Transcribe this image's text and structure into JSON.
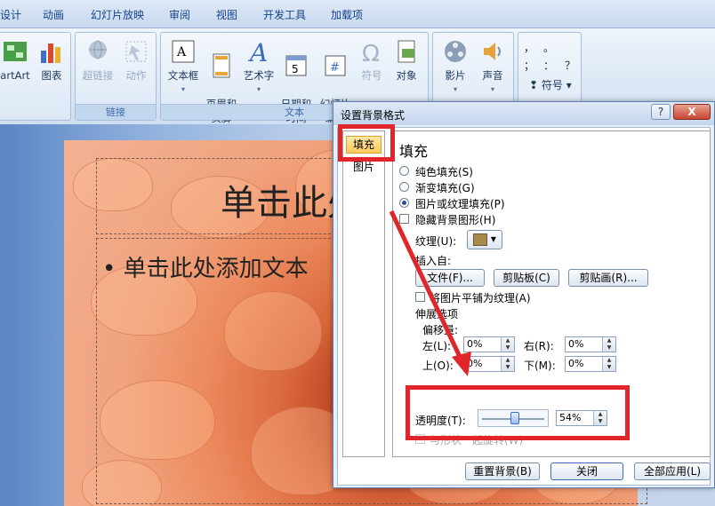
{
  "ribbon_tabs": [
    "设计",
    "动画",
    "幻灯片放映",
    "审阅",
    "视图",
    "开发工具",
    "加载项"
  ],
  "ribbon": {
    "group1": {
      "buttons": [
        {
          "label": "artArt",
          "icon": "smartart-icon"
        },
        {
          "label": "图表",
          "icon": "chart-icon"
        }
      ]
    },
    "group_links": {
      "label": "链接",
      "buttons": [
        {
          "label": "超链接",
          "icon": "hyperlink-icon",
          "disabled": true
        },
        {
          "label": "动作",
          "icon": "action-icon",
          "disabled": true
        }
      ]
    },
    "group_text": {
      "label": "文本",
      "buttons": [
        {
          "label": "文本框",
          "icon": "textbox-icon"
        },
        {
          "label": "页眉和\n页脚",
          "icon": "header-footer-icon"
        },
        {
          "label": "艺术字",
          "icon": "wordart-icon"
        },
        {
          "label": "日期和\n时间",
          "icon": "calendar-icon"
        },
        {
          "label": "幻灯片\n编号",
          "icon": "slide-number-icon"
        },
        {
          "label": "符号",
          "icon": "omega-icon",
          "disabled": true
        },
        {
          "label": "对象",
          "icon": "object-icon"
        }
      ]
    },
    "group_media": {
      "buttons": [
        {
          "label": "影片",
          "icon": "film-icon"
        },
        {
          "label": "声音",
          "icon": "speaker-icon"
        }
      ]
    },
    "group_symbol": {
      "symbols": [
        "，",
        "。",
        "；",
        "：",
        "？"
      ],
      "button": "符号"
    }
  },
  "slide": {
    "title_placeholder": "单击此处添加标题",
    "body_placeholder": "单击此处添加文本"
  },
  "dialog": {
    "title": "设置背景格式",
    "help": "?",
    "close": "X",
    "categories": [
      "填充",
      "图片"
    ],
    "section_title": "填充",
    "fill_options": [
      "纯色填充(S)",
      "渐变填充(G)",
      "图片或纹理填充(P)"
    ],
    "selected_fill": 2,
    "hide_background": "隐藏背景图形(H)",
    "texture_label": "纹理(U):",
    "insert_from": "插入自:",
    "insert_buttons": [
      "文件(F)...",
      "剪贴板(C)",
      "剪贴画(R)..."
    ],
    "tile_checkbox": "将图片平铺为纹理(A)",
    "stretch_options": "伸展选项",
    "offsets": "偏移量:",
    "left_label": "左(L):",
    "left_value": "0%",
    "right_label": "右(R):",
    "right_value": "0%",
    "top_label": "上(O):",
    "top_value": "0%",
    "bottom_label": "下(M):",
    "bottom_value": "0%",
    "transparency_label": "透明度(T):",
    "transparency_value": "54%",
    "transparency_level": 0.54,
    "rotate_checkbox": "与形状一起旋转(W)",
    "footer_buttons": [
      "重置背景(B)",
      "关闭",
      "全部应用(L)"
    ]
  },
  "colors": {
    "highlight": "#e0262a",
    "ribbon_bg": "#dbe7f5",
    "selected_category": "#ffc95a"
  }
}
